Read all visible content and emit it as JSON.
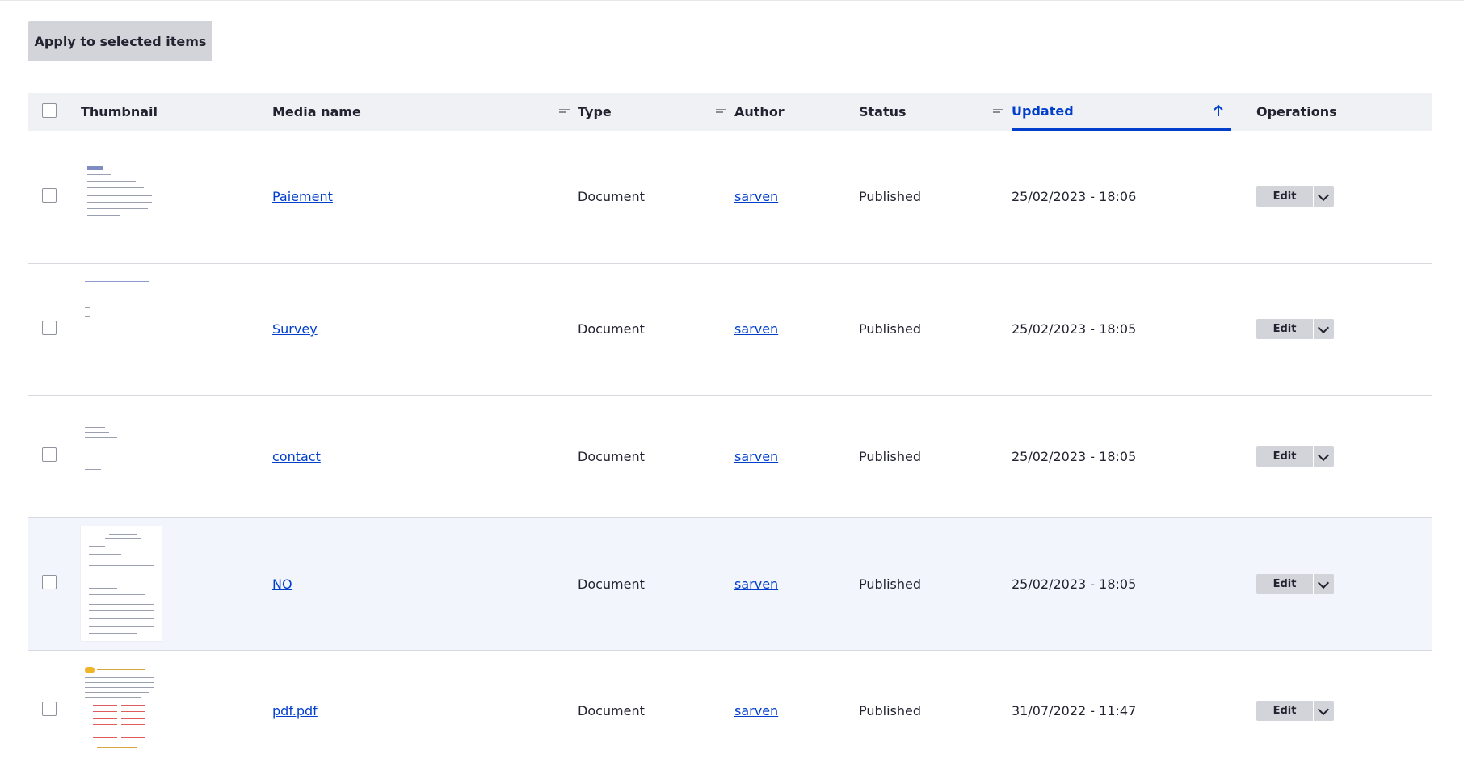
{
  "bulk_action": {
    "label": "Apply to selected items"
  },
  "columns": {
    "thumbnail": "Thumbnail",
    "media_name": "Media name",
    "type": "Type",
    "author": "Author",
    "status": "Status",
    "updated": "Updated",
    "operations": "Operations"
  },
  "sort": {
    "active_column": "Updated",
    "direction": "ascending",
    "icon": "arrow-up-icon"
  },
  "rows": [
    {
      "name": "Paiement",
      "type": "Document",
      "author": "sarven",
      "status": "Published",
      "updated": "25/02/2023 - 18:06",
      "edit": "Edit"
    },
    {
      "name": "Survey",
      "type": "Document",
      "author": "sarven",
      "status": "Published",
      "updated": "25/02/2023 - 18:05",
      "edit": "Edit"
    },
    {
      "name": "contact",
      "type": "Document",
      "author": "sarven",
      "status": "Published",
      "updated": "25/02/2023 - 18:05",
      "edit": "Edit"
    },
    {
      "name": "NO",
      "type": "Document",
      "author": "sarven",
      "status": "Published",
      "updated": "25/02/2023 - 18:05",
      "edit": "Edit"
    },
    {
      "name": "pdf.pdf",
      "type": "Document",
      "author": "sarven",
      "status": "Published",
      "updated": "31/07/2022 - 11:47",
      "edit": "Edit"
    }
  ],
  "colors": {
    "link": "#003ecc",
    "header_bg": "#eff1f5",
    "button_bg": "#d3d4d9",
    "highlight_row": "#f2f5fc"
  }
}
